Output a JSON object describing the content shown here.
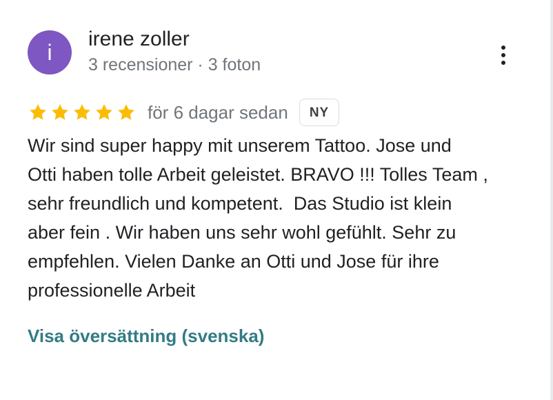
{
  "reviewer": {
    "avatar_letter": "i",
    "avatar_color": "#7e57c2",
    "name": "irene zoller",
    "meta": "3 recensioner · 3 foton"
  },
  "menu": {
    "icon": "more-vert-icon"
  },
  "rating": {
    "stars": 5,
    "max_stars": 5,
    "star_color": "#fbbc04",
    "time": "för 6 dagar sedan",
    "badge": "NY"
  },
  "review": {
    "lines": [
      "Wir sind super happy mit unserem Tattoo. Jose und",
      "Otti haben tolle Arbeit geleistet. BRAVO !!! Tolles Team ,",
      "sehr freundlich und kompetent.  Das Studio ist klein",
      "aber fein . Wir haben uns sehr wohl gefühlt. Sehr zu",
      "empfehlen. Vielen Danke an Otti und Jose für ihre",
      "professionelle Arbeit"
    ]
  },
  "translate_link": "Visa översättning (svenska)"
}
